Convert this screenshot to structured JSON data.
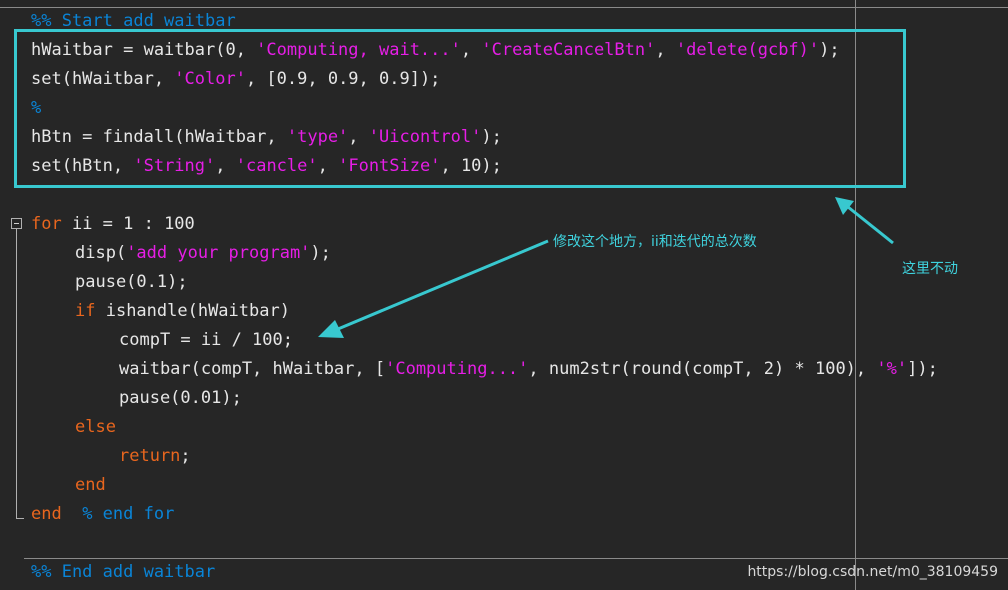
{
  "editor": {
    "section_start": "%% Start add waitbar",
    "section_end": "%% End add waitbar",
    "lines": {
      "l1": {
        "a": "hWaitbar = waitbar(0, ",
        "s1": "'Computing, wait...'",
        "b": ", ",
        "s2": "'CreateCancelBtn'",
        "c": ", ",
        "s3": "'delete(gcbf)'",
        "d": ");"
      },
      "l2": {
        "a": "set(hWaitbar, ",
        "s1": "'Color'",
        "b": ", [0.9, 0.9, 0.9]);"
      },
      "l3": {
        "cm": "%"
      },
      "l4": {
        "a": "hBtn = findall(hWaitbar, ",
        "s1": "'type'",
        "b": ", ",
        "s2": "'Uicontrol'",
        "c": ");"
      },
      "l5": {
        "a": "set(hBtn, ",
        "s1": "'String'",
        "b": ", ",
        "s2": "'cancle'",
        "c": ", ",
        "s3": "'FontSize'",
        "d": ", 10);"
      },
      "l6": {
        "kw": "for",
        "a": " ii = 1 : 100"
      },
      "l7": {
        "a": "disp(",
        "s1": "'add your program'",
        "b": ");"
      },
      "l8": {
        "a": "pause(0.1);"
      },
      "l9": {
        "kw": "if",
        "a": " ishandle(hWaitbar)"
      },
      "l10": {
        "a": "compT = ii / 100;"
      },
      "l11": {
        "a": "waitbar(compT, hWaitbar, [",
        "s1": "'Computing...'",
        "b": ", num2str(round(compT, 2) * 100), ",
        "s2": "'%'",
        "c": "]);"
      },
      "l12": {
        "a": "pause(0.01);"
      },
      "l13": {
        "kw": "else"
      },
      "l14": {
        "kw": "return",
        "a": ";"
      },
      "l15": {
        "kw": "end"
      },
      "l16": {
        "kw": "end",
        "cm": "  % end for"
      }
    }
  },
  "annotations": {
    "modify_note": "修改这个地方，ii和迭代的总次数",
    "keep_note": "这里不动"
  },
  "watermark": "https://blog.csdn.net/m0_38109459",
  "colors": {
    "background": "#262626",
    "comment": "#0a84d6",
    "keyword": "#e8661e",
    "string": "#e61ee6",
    "annotation": "#38c8cf"
  }
}
